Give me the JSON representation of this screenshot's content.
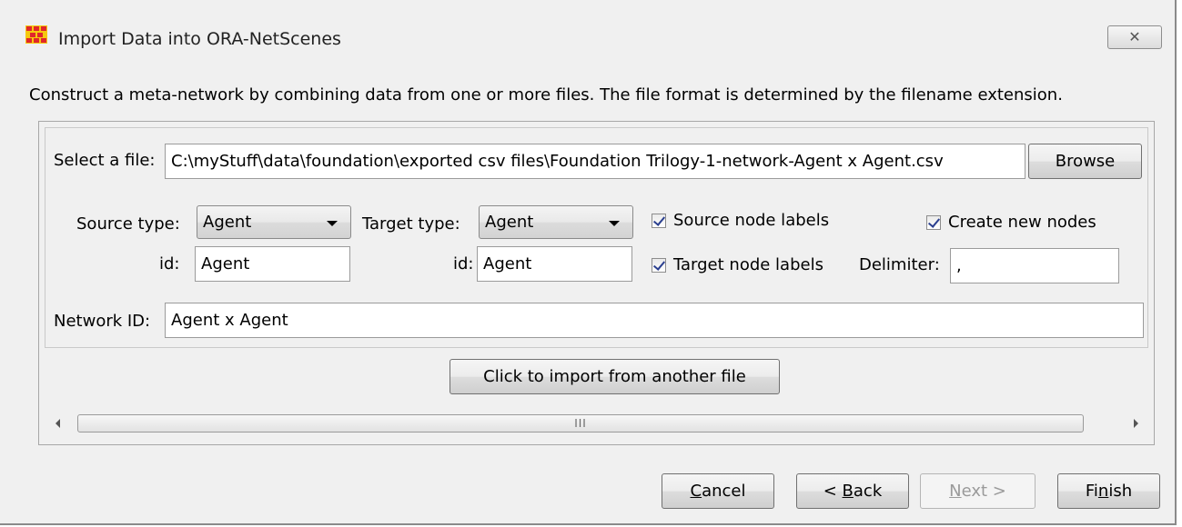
{
  "window": {
    "title": "Import Data into ORA-NetScenes",
    "close_glyph": "✕"
  },
  "description": "Construct a meta-network by combining data from one or more files. The file format is determined by the filename extension.",
  "file": {
    "select_label": "Select a file:",
    "path": "C:\\myStuff\\data\\foundation\\exported csv files\\Foundation Trilogy-1-network-Agent x Agent.csv",
    "browse_label": "Browse"
  },
  "source": {
    "type_label": "Source type:",
    "type_value": "Agent",
    "id_label": "id:",
    "id_value": "Agent"
  },
  "target": {
    "type_label": "Target type:",
    "type_value": "Agent",
    "id_label": "id:",
    "id_value": "Agent"
  },
  "options": {
    "source_node_labels": "Source node labels",
    "target_node_labels": "Target node labels",
    "create_new_nodes": "Create new nodes",
    "delimiter_label": "Delimiter:",
    "delimiter_value": ","
  },
  "network": {
    "id_label": "Network ID:",
    "id_value": "Agent x Agent"
  },
  "import_another_label": "Click to import from another file",
  "scroll_thumb_grip": "III",
  "footer": {
    "cancel_mnemonic": "C",
    "cancel_rest": "ancel",
    "back_prefix": "< ",
    "back_mnemonic": "B",
    "back_rest": "ack",
    "next_mnemonic": "N",
    "next_rest": "ext >",
    "finish_prefix": "Fi",
    "finish_mnemonic": "n",
    "finish_rest": "ish"
  },
  "colors": {
    "icon_red": "#e0272b",
    "icon_yellow": "#f6c90e",
    "check_mark": "#2a3f8f"
  }
}
